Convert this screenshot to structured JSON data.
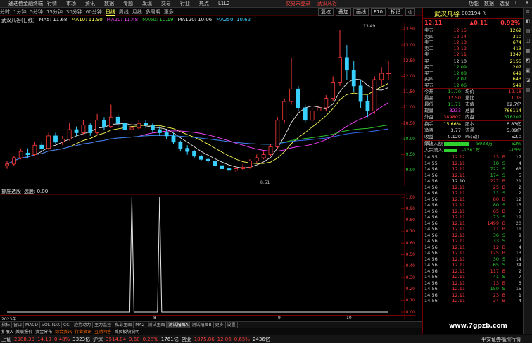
{
  "menu": {
    "app_title": "通达信金融终端",
    "items": [
      "行情",
      "市场",
      "资讯",
      "数据",
      "专题",
      "发现",
      "交易",
      "行业",
      "热点",
      "L1L2"
    ],
    "center": [
      "交易未登录",
      "武汉凡谷"
    ],
    "right": [
      "功能",
      "数据",
      "选股",
      "☐",
      "✕"
    ]
  },
  "periods": [
    "分时",
    "1分钟",
    "5分钟",
    "15分钟",
    "30分钟",
    "60分钟",
    "日线",
    "周线",
    "月线",
    "多周期",
    "更多"
  ],
  "active_period": "日线",
  "tools": [
    "复权",
    "叠加",
    "画线",
    "F10",
    "标记",
    "◎"
  ],
  "info": {
    "name": "武汉凡谷(日线)",
    "ma5": "MA5: 11.68",
    "ma10": "MA10: 11.90",
    "ma20": "MA20: 11.48",
    "ma60": "MA60: 10.19",
    "ma120": "MA120: 10.06",
    "ma250": "MA250: 10.62"
  },
  "price_axis": [
    "13.50",
    "13.00",
    "12.50",
    "12.00",
    "11.50",
    "11.00",
    "10.50",
    "10.00",
    "9.50",
    "9.00"
  ],
  "chart_labels": {
    "high": "13.49",
    "low": "8.51"
  },
  "candles": [
    [
      9.15,
      9.2,
      9.3,
      9.05
    ],
    [
      9.2,
      9.4,
      9.45,
      9.15
    ],
    [
      9.4,
      9.6,
      9.7,
      9.35
    ],
    [
      9.55,
      9.5,
      9.7,
      9.4
    ],
    [
      9.5,
      9.8,
      9.9,
      9.45
    ],
    [
      9.8,
      9.7,
      9.9,
      9.6
    ],
    [
      9.7,
      10.1,
      10.2,
      9.65
    ],
    [
      10.1,
      9.9,
      10.2,
      9.85
    ],
    [
      9.9,
      10.0,
      10.1,
      9.8
    ],
    [
      10.0,
      10.3,
      10.5,
      9.95
    ],
    [
      10.3,
      10.2,
      10.4,
      10.1
    ],
    [
      10.2,
      10.45,
      10.6,
      10.15
    ],
    [
      10.45,
      10.2,
      10.5,
      10.1
    ],
    [
      10.2,
      10.6,
      10.8,
      10.15
    ],
    [
      10.6,
      10.4,
      10.7,
      10.3
    ],
    [
      10.4,
      10.7,
      11.1,
      10.35
    ],
    [
      10.7,
      10.5,
      10.8,
      10.4
    ],
    [
      10.5,
      10.3,
      10.6,
      10.25
    ],
    [
      10.3,
      10.35,
      10.5,
      10.2
    ],
    [
      10.35,
      10.5,
      10.6,
      10.3
    ],
    [
      10.5,
      10.45,
      10.6,
      10.35
    ],
    [
      10.45,
      10.3,
      10.5,
      10.2
    ],
    [
      10.3,
      10.2,
      10.4,
      10.1
    ],
    [
      10.2,
      10.1,
      10.3,
      10.0
    ],
    [
      10.1,
      9.9,
      10.2,
      9.85
    ],
    [
      9.9,
      9.7,
      9.95,
      9.6
    ],
    [
      9.7,
      9.6,
      9.8,
      9.5
    ],
    [
      9.6,
      9.45,
      9.65,
      9.4
    ],
    [
      9.45,
      9.35,
      9.5,
      9.3
    ],
    [
      9.35,
      9.3,
      9.4,
      9.25
    ],
    [
      9.3,
      9.15,
      9.35,
      9.1
    ],
    [
      9.15,
      9.05,
      9.2,
      9.0
    ],
    [
      9.05,
      9.0,
      9.1,
      8.95
    ],
    [
      9.0,
      9.05,
      9.15,
      8.95
    ],
    [
      9.05,
      9.1,
      9.2,
      9.0
    ],
    [
      9.1,
      9.3,
      9.35,
      9.05
    ],
    [
      9.3,
      9.4,
      9.5,
      9.25
    ],
    [
      9.4,
      9.5,
      9.6,
      9.35
    ],
    [
      9.5,
      9.75,
      9.85,
      9.45
    ],
    [
      9.75,
      10.6,
      10.7,
      9.7
    ],
    [
      10.6,
      11.2,
      11.3,
      10.5
    ],
    [
      11.2,
      11.6,
      12.6,
      11.1
    ],
    [
      11.6,
      11.0,
      11.7,
      10.9
    ],
    [
      11.0,
      10.6,
      11.1,
      10.5
    ],
    [
      10.6,
      10.9,
      11.0,
      10.5
    ],
    [
      10.9,
      11.0,
      11.2,
      10.8
    ],
    [
      11.0,
      11.3,
      11.4,
      10.9
    ],
    [
      11.3,
      11.8,
      12.0,
      11.2
    ],
    [
      11.8,
      12.6,
      13.49,
      11.7
    ],
    [
      12.6,
      12.2,
      13.0,
      11.9
    ],
    [
      12.2,
      11.7,
      12.5,
      11.5
    ],
    [
      11.7,
      11.2,
      11.9,
      11.0
    ],
    [
      11.2,
      10.9,
      11.4,
      10.7
    ],
    [
      10.9,
      11.9,
      12.0,
      10.8
    ],
    [
      11.9,
      12.1,
      12.3,
      11.7
    ],
    [
      12.1,
      12.11,
      12.5,
      11.9
    ]
  ],
  "sub_info": {
    "name": "抓庄选股",
    "label": "选股: 0.00"
  },
  "sub_axis": [
    "1.00",
    "0.90",
    "0.80",
    "0.70",
    "0.60",
    "0.50",
    "0.40",
    "0.30",
    "0.20",
    "0.10",
    "0.00"
  ],
  "sub_signals": [
    {
      "index": 18,
      "value": 1.0
    },
    {
      "index": 22,
      "value": 1.0
    }
  ],
  "dates": [
    "2023年",
    "8",
    "9",
    "10"
  ],
  "tabs": [
    "指标",
    "窗口",
    "MACD",
    "VOL-TDX",
    "CCI",
    "趋势动力",
    "主力监控",
    "私募主图",
    "MA2",
    "测试主图",
    "测试幅图A",
    "测试幅图B",
    "更多",
    "设置"
  ],
  "links": [
    "扩展A",
    "关联报价",
    "资金分布",
    "综合资讯",
    "行业资讯",
    "互动问答",
    "首页板块说明"
  ],
  "stock": {
    "name": "武汉凡谷",
    "code": "002194",
    "badge": "R",
    "price": "12.11",
    "change": "▲0.11",
    "pct": "0.92%"
  },
  "asks": [
    {
      "label": "卖五",
      "price": "12.15",
      "vol": "1262"
    },
    {
      "label": "卖四",
      "price": "12.14",
      "vol": "310"
    },
    {
      "label": "卖三",
      "price": "12.13",
      "vol": "674"
    },
    {
      "label": "卖二",
      "price": "12.12",
      "vol": "413"
    },
    {
      "label": "卖一",
      "price": "12.11",
      "vol": "1347"
    }
  ],
  "bids": [
    {
      "label": "买一",
      "price": "12.10",
      "vol": "2155"
    },
    {
      "label": "买二",
      "price": "12.09",
      "vol": "207"
    },
    {
      "label": "买三",
      "price": "12.08",
      "vol": "649"
    },
    {
      "label": "买四",
      "price": "12.07",
      "vol": "643"
    },
    {
      "label": "买五",
      "price": "12.06",
      "vol": "549"
    }
  ],
  "stats": [
    {
      "k1": "今开",
      "v1": "11.70",
      "c1": "down",
      "k2": "均价",
      "v2": "12.18",
      "c2": "up"
    },
    {
      "k1": "最高",
      "v1": "12.50",
      "c1": "up",
      "k2": "量比",
      "v2": "1.35",
      "c2": "up"
    },
    {
      "k1": "最低",
      "v1": "11.71",
      "c1": "down",
      "k2": "市值",
      "v2": "82.7亿",
      "c2": "wht"
    },
    {
      "k1": "现量",
      "v1": "8233",
      "c1": "mag",
      "k2": "总量",
      "v2": "766114",
      "c2": "yel"
    },
    {
      "k1": "外盘",
      "v1": "389807",
      "c1": "up",
      "k2": "内盘",
      "v2": "376307",
      "c2": "down"
    }
  ],
  "stats2": [
    {
      "k1": "换手",
      "v1": "15.66%",
      "c1": "yel",
      "k2": "股本",
      "v2": "6.83亿",
      "c2": "wht"
    },
    {
      "k1": "净资",
      "v1": "3.77",
      "c1": "wht",
      "k2": "流通",
      "v2": "5.09亿",
      "c2": "wht"
    },
    {
      "k1": "收益(三)",
      "v1": "0.120",
      "c1": "wht",
      "k2": "PE(动)",
      "v2": "52.0",
      "c2": "wht"
    }
  ],
  "flows": [
    {
      "label": "净流入额",
      "value": "-5933万",
      "pct": "-62%",
      "color": "#2fd12f",
      "width": 36
    },
    {
      "label": "大宗流入",
      "value": "-1381万",
      "pct": "-15%",
      "color": "#2fd12f",
      "width": 18
    }
  ],
  "ticks": [
    [
      "14:55",
      "12.12",
      "13",
      "B",
      "17"
    ],
    [
      "14:55",
      "12.11",
      "18",
      "S",
      "4"
    ],
    [
      "14:56",
      "12.11",
      "722",
      "S",
      "65"
    ],
    [
      "14:56",
      "12.11",
      "174",
      "S",
      "5"
    ],
    [
      "14:56",
      "12.10",
      "227",
      "B",
      "21"
    ],
    [
      "14:56",
      "12.11",
      "25",
      "B",
      "2"
    ],
    [
      "14:56",
      "12.11",
      "11",
      "S",
      "2"
    ],
    [
      "14:56",
      "12.11",
      "80",
      "B",
      "12"
    ],
    [
      "14:56",
      "12.11",
      "80",
      "S",
      "13"
    ],
    [
      "14:56",
      "12.11",
      "65",
      "B",
      "7"
    ],
    [
      "14:56",
      "12.11",
      "73",
      "S",
      "19"
    ],
    [
      "14:56",
      "12.11",
      "1499",
      "B",
      "20"
    ],
    [
      "14:56",
      "12.11",
      "11",
      "B",
      "11"
    ],
    [
      "14:56",
      "12.11",
      "36",
      "S",
      "9"
    ],
    [
      "14:56",
      "12.11",
      "33",
      "S",
      "7"
    ],
    [
      "14:56",
      "12.11",
      "12",
      "B",
      "4"
    ],
    [
      "14:56",
      "12.11",
      "125",
      "B",
      "13"
    ],
    [
      "14:56",
      "12.11",
      "30",
      "S",
      "14"
    ],
    [
      "14:56",
      "12.11",
      "65",
      "S",
      "34"
    ],
    [
      "14:56",
      "12.11",
      "117",
      "B",
      "2"
    ],
    [
      "14:56",
      "12.11",
      "41",
      "S",
      "7"
    ],
    [
      "14:56",
      "12.11",
      "13",
      "B",
      "5"
    ],
    [
      "14:56",
      "12.11",
      "150",
      "S",
      "15"
    ],
    [
      "14:56",
      "12.11",
      "23",
      "B",
      "1"
    ],
    [
      "14:56",
      "12.11",
      "34",
      "B",
      "4"
    ]
  ],
  "status": {
    "sh_label": "上证",
    "sh_val": "2988.30",
    "sh_chg": "14.19",
    "sh_pct": "0.48%",
    "sh_amt": "3323亿",
    "hs_label": "沪深",
    "hs_val": "3514.04",
    "hs_chg": "9.68",
    "hs_pct": "0.28%",
    "hs_amt": "1761亿",
    "cy_label": "创业",
    "cy_val": "1875.86",
    "cy_chg": "12.06",
    "cy_pct": "0.65%",
    "cy_amt": "2436亿",
    "right": "平安证券福州行情"
  },
  "watermark": "www.7gpzb.com",
  "chart_data": {
    "type": "candlestick",
    "ylim": [
      8.5,
      13.7
    ]
  }
}
